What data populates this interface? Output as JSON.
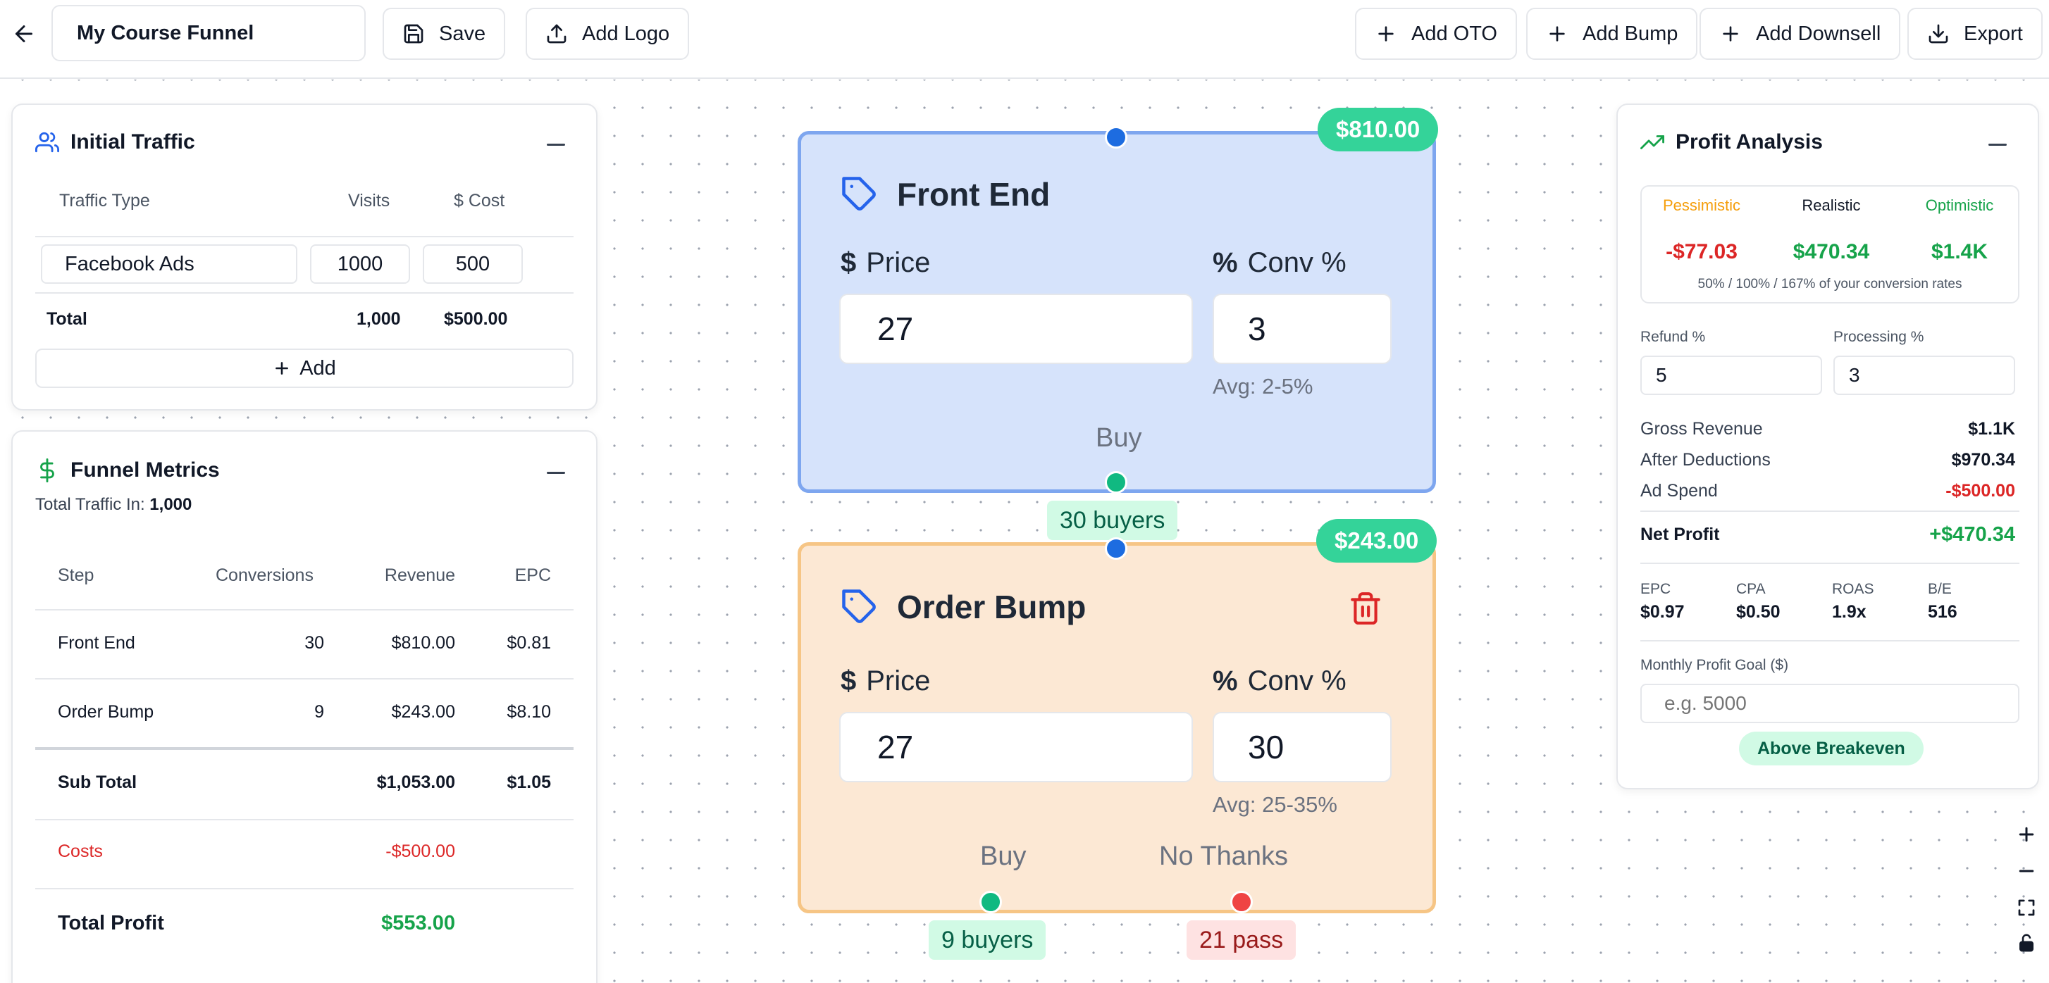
{
  "toolbar": {
    "funnel_name": "My Course Funnel",
    "save_label": "Save",
    "add_logo_label": "Add Logo",
    "add_oto_label": "Add OTO",
    "add_bump_label": "Add Bump",
    "add_downsell_label": "Add Downsell",
    "export_label": "Export"
  },
  "traffic": {
    "title": "Initial Traffic",
    "headers": {
      "type": "Traffic Type",
      "visits": "Visits",
      "cost": "$ Cost"
    },
    "rows": [
      {
        "type": "Facebook Ads",
        "visits": "1000",
        "cost": "500"
      }
    ],
    "total_label": "Total",
    "total_visits": "1,000",
    "total_cost": "$500.00",
    "add_label": "Add"
  },
  "metrics": {
    "title": "Funnel Metrics",
    "traffic_in_label": "Total Traffic In:",
    "traffic_in_value": "1,000",
    "headers": {
      "step": "Step",
      "conversions": "Conversions",
      "revenue": "Revenue",
      "epc": "EPC"
    },
    "rows": [
      {
        "step": "Front End",
        "conversions": "30",
        "revenue": "$810.00",
        "epc": "$0.81"
      },
      {
        "step": "Order Bump",
        "conversions": "9",
        "revenue": "$243.00",
        "epc": "$8.10"
      }
    ],
    "subtotal": {
      "label": "Sub Total",
      "revenue": "$1,053.00",
      "epc": "$1.05"
    },
    "costs": {
      "label": "Costs",
      "value": "-$500.00"
    },
    "total_profit": {
      "label": "Total Profit",
      "value": "$553.00"
    }
  },
  "nodes": {
    "front_end": {
      "title": "Front End",
      "badge": "$810.00",
      "price_label": "Price",
      "price_symbol": "$",
      "price_value": "27",
      "conv_label": "Conv %",
      "conv_symbol": "%",
      "conv_value": "3",
      "avg": "Avg: 2-5%",
      "buy_label": "Buy",
      "buyers_chip": "30 buyers"
    },
    "order_bump": {
      "title": "Order Bump",
      "badge": "$243.00",
      "price_label": "Price",
      "price_symbol": "$",
      "price_value": "27",
      "conv_label": "Conv %",
      "conv_symbol": "%",
      "conv_value": "30",
      "avg": "Avg: 25-35%",
      "buy_label": "Buy",
      "no_thanks_label": "No Thanks",
      "buyers_chip": "9 buyers",
      "pass_chip": "21 pass"
    }
  },
  "profit": {
    "title": "Profit Analysis",
    "scenarios": [
      {
        "name": "Pessimistic",
        "value": "-$77.03"
      },
      {
        "name": "Realistic",
        "value": "$470.34"
      },
      {
        "name": "Optimistic",
        "value": "$1.4K"
      }
    ],
    "scenario_note": "50% / 100% / 167% of your conversion rates",
    "refund_label": "Refund %",
    "refund_value": "5",
    "processing_label": "Processing %",
    "processing_value": "3",
    "gross_label": "Gross Revenue",
    "gross_value": "$1.1K",
    "after_label": "After Deductions",
    "after_value": "$970.34",
    "adspend_label": "Ad Spend",
    "adspend_value": "-$500.00",
    "net_label": "Net Profit",
    "net_value": "+$470.34",
    "kpis": [
      {
        "label": "EPC",
        "value": "$0.97"
      },
      {
        "label": "CPA",
        "value": "$0.50"
      },
      {
        "label": "ROAS",
        "value": "1.9x"
      },
      {
        "label": "B/E",
        "value": "516"
      }
    ],
    "goal_label": "Monthly Profit Goal ($)",
    "goal_placeholder": "e.g. 5000",
    "breakeven_badge": "Above Breakeven"
  },
  "colors": {
    "positive": "#16a34a",
    "negative": "#dc2626",
    "pessimistic": "#f59e0b",
    "optimistic": "#16a34a",
    "accent_blue": "#2563eb",
    "badge_green": "#34d399"
  }
}
